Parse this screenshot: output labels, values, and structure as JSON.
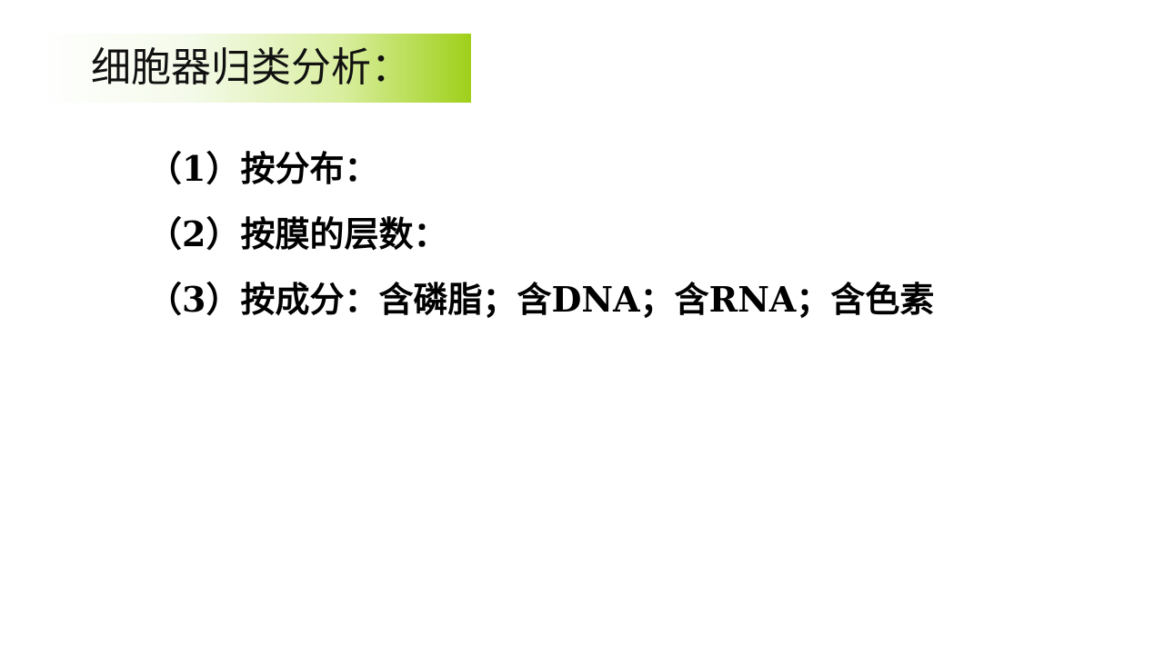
{
  "slide": {
    "title": "细胞器归类分析：",
    "items": [
      {
        "label": "（1）按分布："
      },
      {
        "label": "（2）按膜的层数："
      },
      {
        "label": "（3）按成分：含磷脂；含DNA；含RNA；含色素"
      }
    ]
  },
  "colors": {
    "title_gradient_start": "#ffffff",
    "title_gradient_end": "#9fd01a",
    "text": "#000000"
  }
}
